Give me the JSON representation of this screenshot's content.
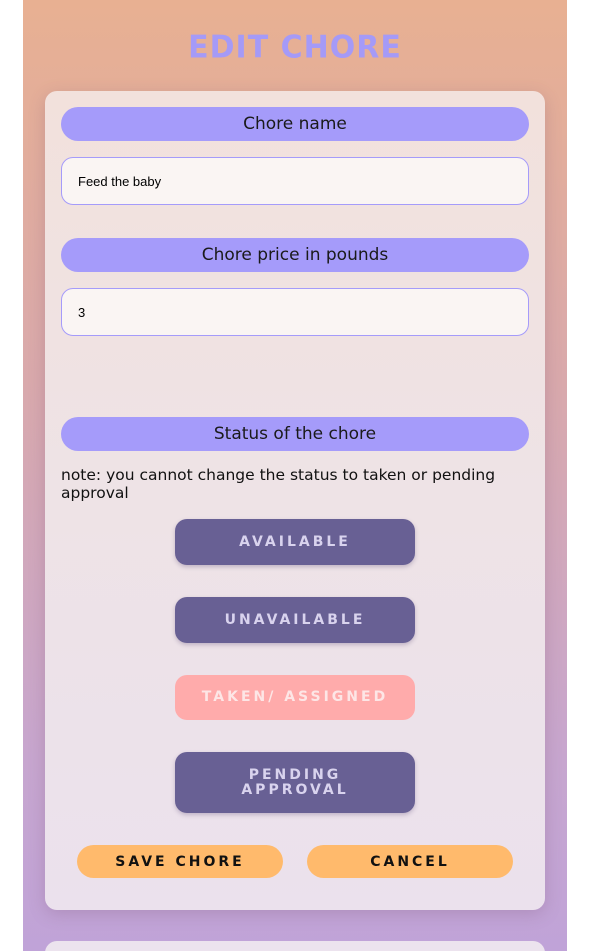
{
  "page": {
    "title": "Edit Chore"
  },
  "form": {
    "name_label": "Chore name",
    "name_value": "Feed the baby",
    "price_label": "Chore price in pounds",
    "price_value": "3",
    "status_label": "Status of the chore",
    "status_note": "note: you cannot change the status to taken or pending approval"
  },
  "status_options": {
    "available": "Available",
    "unavailable": "Unavailable",
    "taken": "Taken/ Assigned",
    "pending": "Pending Approval",
    "current": "Taken/ Assigned"
  },
  "actions": {
    "save_label": "Save Chore",
    "cancel_label": "Cancel"
  },
  "colors": {
    "accent_purple": "#a59bfa",
    "button_purple": "#686094",
    "selected_pink": "#ffabab",
    "action_orange": "#ffba6c"
  }
}
